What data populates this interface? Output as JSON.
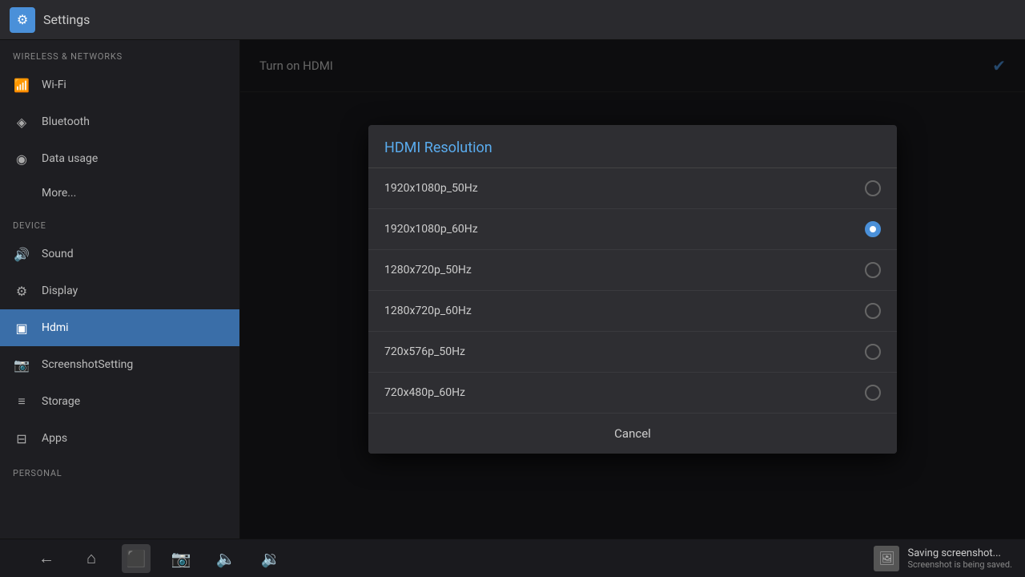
{
  "titleBar": {
    "title": "Settings",
    "iconUnicode": "⊞"
  },
  "sidebar": {
    "sections": [
      {
        "header": "WIRELESS & NETWORKS",
        "items": [
          {
            "id": "wifi",
            "label": "Wi-Fi",
            "icon": "📶",
            "active": false
          },
          {
            "id": "bluetooth",
            "label": "Bluetooth",
            "icon": "🔷",
            "active": false
          },
          {
            "id": "data-usage",
            "label": "Data usage",
            "icon": "⊙",
            "active": false
          },
          {
            "id": "more",
            "label": "More...",
            "icon": "",
            "active": false,
            "indent": true
          }
        ]
      },
      {
        "header": "DEVICE",
        "items": [
          {
            "id": "sound",
            "label": "Sound",
            "icon": "🔊",
            "active": false
          },
          {
            "id": "display",
            "label": "Display",
            "icon": "⚙",
            "active": false
          },
          {
            "id": "hdmi",
            "label": "Hdmi",
            "icon": "▣",
            "active": true
          },
          {
            "id": "screenshot",
            "label": "ScreenshotSetting",
            "icon": "📷",
            "active": false
          },
          {
            "id": "storage",
            "label": "Storage",
            "icon": "≡",
            "active": false
          },
          {
            "id": "apps",
            "label": "Apps",
            "icon": "⊟",
            "active": false
          }
        ]
      },
      {
        "header": "PERSONAL",
        "items": []
      }
    ]
  },
  "content": {
    "turnOnHdmi": {
      "label": "Turn on HDMI",
      "checked": true
    }
  },
  "dialog": {
    "title": "HDMI Resolution",
    "options": [
      {
        "id": "r1",
        "label": "1920x1080p_50Hz",
        "selected": false
      },
      {
        "id": "r2",
        "label": "1920x1080p_60Hz",
        "selected": true
      },
      {
        "id": "r3",
        "label": "1280x720p_50Hz",
        "selected": false
      },
      {
        "id": "r4",
        "label": "1280x720p_60Hz",
        "selected": false
      },
      {
        "id": "r5",
        "label": "720x576p_50Hz",
        "selected": false
      },
      {
        "id": "r6",
        "label": "720x480p_60Hz",
        "selected": false
      }
    ],
    "cancelLabel": "Cancel"
  },
  "bottomBar": {
    "buttons": [
      {
        "id": "back",
        "icon": "←",
        "label": "back-button"
      },
      {
        "id": "home",
        "icon": "⌂",
        "label": "home-button"
      },
      {
        "id": "recents",
        "icon": "⬛",
        "label": "recents-button",
        "active": true
      },
      {
        "id": "screenshot-btn",
        "icon": "📷",
        "label": "screenshot-button"
      },
      {
        "id": "vol-down",
        "icon": "🔈",
        "label": "volume-down-button"
      },
      {
        "id": "vol-up",
        "icon": "🔉",
        "label": "volume-up-button"
      }
    ],
    "notification": {
      "line1": "Saving screenshot...",
      "line2": "Screenshot is being saved."
    }
  }
}
